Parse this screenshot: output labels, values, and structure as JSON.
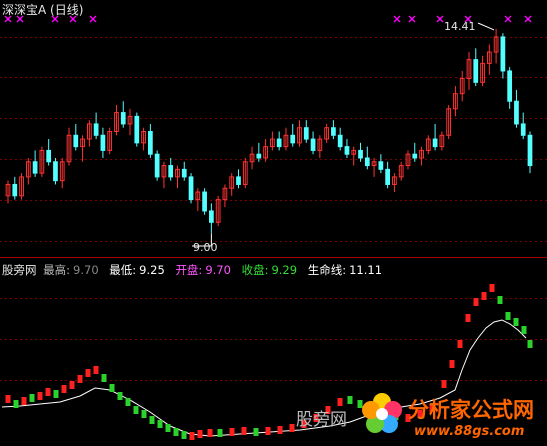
{
  "header": {
    "title": "深深宝A (日线)"
  },
  "annotations": {
    "high_label": "14.41",
    "low_label": "9.00"
  },
  "indicator": {
    "name": "股旁网",
    "high_label": "最高:",
    "high_value": "9.70",
    "low_label": "最低:",
    "low_value": "9.25",
    "open_label": "开盘:",
    "open_value": "9.70",
    "close_label": "收盘:",
    "close_value": "9.29",
    "lifeline_label": "生命线:",
    "lifeline_value": "11.11"
  },
  "watermark": {
    "site_text": "股旁网",
    "brand_text": "分析家公式网",
    "url_text": "www.88gs.com"
  },
  "colors": {
    "background": "#000000",
    "up": "#ff3333",
    "down": "#54ffff",
    "grid": "#7a0000",
    "signal": "#ff00ff",
    "lifeline": "#ffffff",
    "ind_up": "#ff2020",
    "ind_down": "#2cd22c",
    "brand": "#ff6600"
  },
  "chart_data": {
    "type": "candlestick",
    "price_range": [
      8.7,
      14.7
    ],
    "candles": [
      [
        10.0,
        10.4,
        9.8,
        10.3
      ],
      [
        10.3,
        10.5,
        9.9,
        10.0
      ],
      [
        10.0,
        10.6,
        9.9,
        10.5
      ],
      [
        10.5,
        11.0,
        10.3,
        10.9
      ],
      [
        10.9,
        11.2,
        10.5,
        10.6
      ],
      [
        10.6,
        11.3,
        10.5,
        11.2
      ],
      [
        11.2,
        11.5,
        10.8,
        10.9
      ],
      [
        10.9,
        11.0,
        10.3,
        10.4
      ],
      [
        10.4,
        11.0,
        10.2,
        10.9
      ],
      [
        10.9,
        11.8,
        10.8,
        11.6
      ],
      [
        11.6,
        11.9,
        11.2,
        11.3
      ],
      [
        11.3,
        11.6,
        10.9,
        11.5
      ],
      [
        11.5,
        12.0,
        11.3,
        11.9
      ],
      [
        11.9,
        12.2,
        11.5,
        11.6
      ],
      [
        11.6,
        11.8,
        11.0,
        11.2
      ],
      [
        11.2,
        11.8,
        11.1,
        11.7
      ],
      [
        11.7,
        12.4,
        11.6,
        12.2
      ],
      [
        12.2,
        12.5,
        11.8,
        11.9
      ],
      [
        11.9,
        12.3,
        11.6,
        12.1
      ],
      [
        12.1,
        12.2,
        11.3,
        11.4
      ],
      [
        11.4,
        11.8,
        11.2,
        11.7
      ],
      [
        11.7,
        11.9,
        11.0,
        11.1
      ],
      [
        11.1,
        11.2,
        10.4,
        10.5
      ],
      [
        10.5,
        10.9,
        10.2,
        10.8
      ],
      [
        10.8,
        11.0,
        10.4,
        10.5
      ],
      [
        10.5,
        10.8,
        10.2,
        10.7
      ],
      [
        10.7,
        10.9,
        10.4,
        10.5
      ],
      [
        10.5,
        10.6,
        9.8,
        9.9
      ],
      [
        9.9,
        10.2,
        9.6,
        10.1
      ],
      [
        10.1,
        10.2,
        9.5,
        9.6
      ],
      [
        9.6,
        9.8,
        9.0,
        9.3
      ],
      [
        9.3,
        10.0,
        9.2,
        9.9
      ],
      [
        9.9,
        10.3,
        9.7,
        10.2
      ],
      [
        10.2,
        10.6,
        10.0,
        10.5
      ],
      [
        10.5,
        10.7,
        10.2,
        10.3
      ],
      [
        10.3,
        11.0,
        10.2,
        10.9
      ],
      [
        10.9,
        11.3,
        10.7,
        11.1
      ],
      [
        11.1,
        11.4,
        10.9,
        11.0
      ],
      [
        11.0,
        11.5,
        10.9,
        11.3
      ],
      [
        11.3,
        11.7,
        11.2,
        11.5
      ],
      [
        11.5,
        11.7,
        11.2,
        11.3
      ],
      [
        11.3,
        11.8,
        11.2,
        11.6
      ],
      [
        11.6,
        11.9,
        11.3,
        11.4
      ],
      [
        11.4,
        12.0,
        11.3,
        11.8
      ],
      [
        11.8,
        12.0,
        11.4,
        11.5
      ],
      [
        11.5,
        11.7,
        11.1,
        11.2
      ],
      [
        11.2,
        11.6,
        11.0,
        11.5
      ],
      [
        11.5,
        11.9,
        11.4,
        11.8
      ],
      [
        11.8,
        12.0,
        11.5,
        11.6
      ],
      [
        11.6,
        11.8,
        11.2,
        11.3
      ],
      [
        11.3,
        11.5,
        11.0,
        11.1
      ],
      [
        11.1,
        11.3,
        10.8,
        11.2
      ],
      [
        11.2,
        11.4,
        10.9,
        11.0
      ],
      [
        11.0,
        11.3,
        10.7,
        10.8
      ],
      [
        10.8,
        11.0,
        10.5,
        10.9
      ],
      [
        10.9,
        11.1,
        10.6,
        10.7
      ],
      [
        10.7,
        10.9,
        10.2,
        10.3
      ],
      [
        10.3,
        10.6,
        10.1,
        10.5
      ],
      [
        10.5,
        10.9,
        10.4,
        10.8
      ],
      [
        10.8,
        11.2,
        10.7,
        11.1
      ],
      [
        11.1,
        11.4,
        10.9,
        11.0
      ],
      [
        11.0,
        11.3,
        10.8,
        11.2
      ],
      [
        11.2,
        11.6,
        11.1,
        11.5
      ],
      [
        11.5,
        11.9,
        11.2,
        11.3
      ],
      [
        11.3,
        11.7,
        11.2,
        11.6
      ],
      [
        11.6,
        12.4,
        11.5,
        12.3
      ],
      [
        12.3,
        12.9,
        12.1,
        12.7
      ],
      [
        12.7,
        13.3,
        12.5,
        13.1
      ],
      [
        13.1,
        13.8,
        12.8,
        13.6
      ],
      [
        13.6,
        13.9,
        12.9,
        13.0
      ],
      [
        13.0,
        13.7,
        12.9,
        13.5
      ],
      [
        13.5,
        14.0,
        13.2,
        13.8
      ],
      [
        13.8,
        14.41,
        13.5,
        14.2
      ],
      [
        14.2,
        14.3,
        13.1,
        13.3
      ],
      [
        13.3,
        13.4,
        12.3,
        12.5
      ],
      [
        12.5,
        12.8,
        11.8,
        11.9
      ],
      [
        11.9,
        12.2,
        11.5,
        11.6
      ],
      [
        11.6,
        11.7,
        10.6,
        10.8
      ]
    ]
  }
}
